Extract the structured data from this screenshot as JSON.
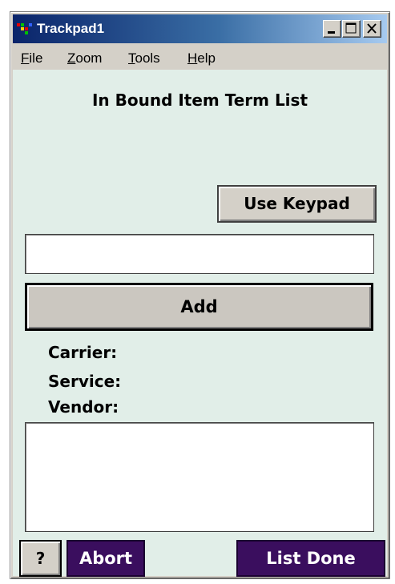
{
  "window": {
    "title": "Trackpad1",
    "controls": {
      "minimize": "minimize",
      "maximize": "maximize",
      "close": "close"
    }
  },
  "menu": {
    "items": [
      {
        "accel": "F",
        "rest": "ile"
      },
      {
        "accel": "Z",
        "rest": "oom"
      },
      {
        "accel": "T",
        "rest": "ools"
      },
      {
        "accel": "H",
        "rest": "elp"
      }
    ]
  },
  "main": {
    "heading": "In Bound Item Term List",
    "use_keypad_label": "Use Keypad",
    "entry_value": "",
    "add_label": "Add",
    "carrier_label": "Carrier:",
    "service_label": "Service:",
    "vendor_label": "Vendor:",
    "items_list": []
  },
  "footer": {
    "help_label": "?",
    "abort_label": "Abort",
    "list_done_label": "List Done"
  },
  "colors": {
    "client_background": "#e1eee8",
    "footer_button_purple": "#3a0e5e",
    "titlebar_start": "#0a246a",
    "titlebar_end": "#a6caf0"
  }
}
